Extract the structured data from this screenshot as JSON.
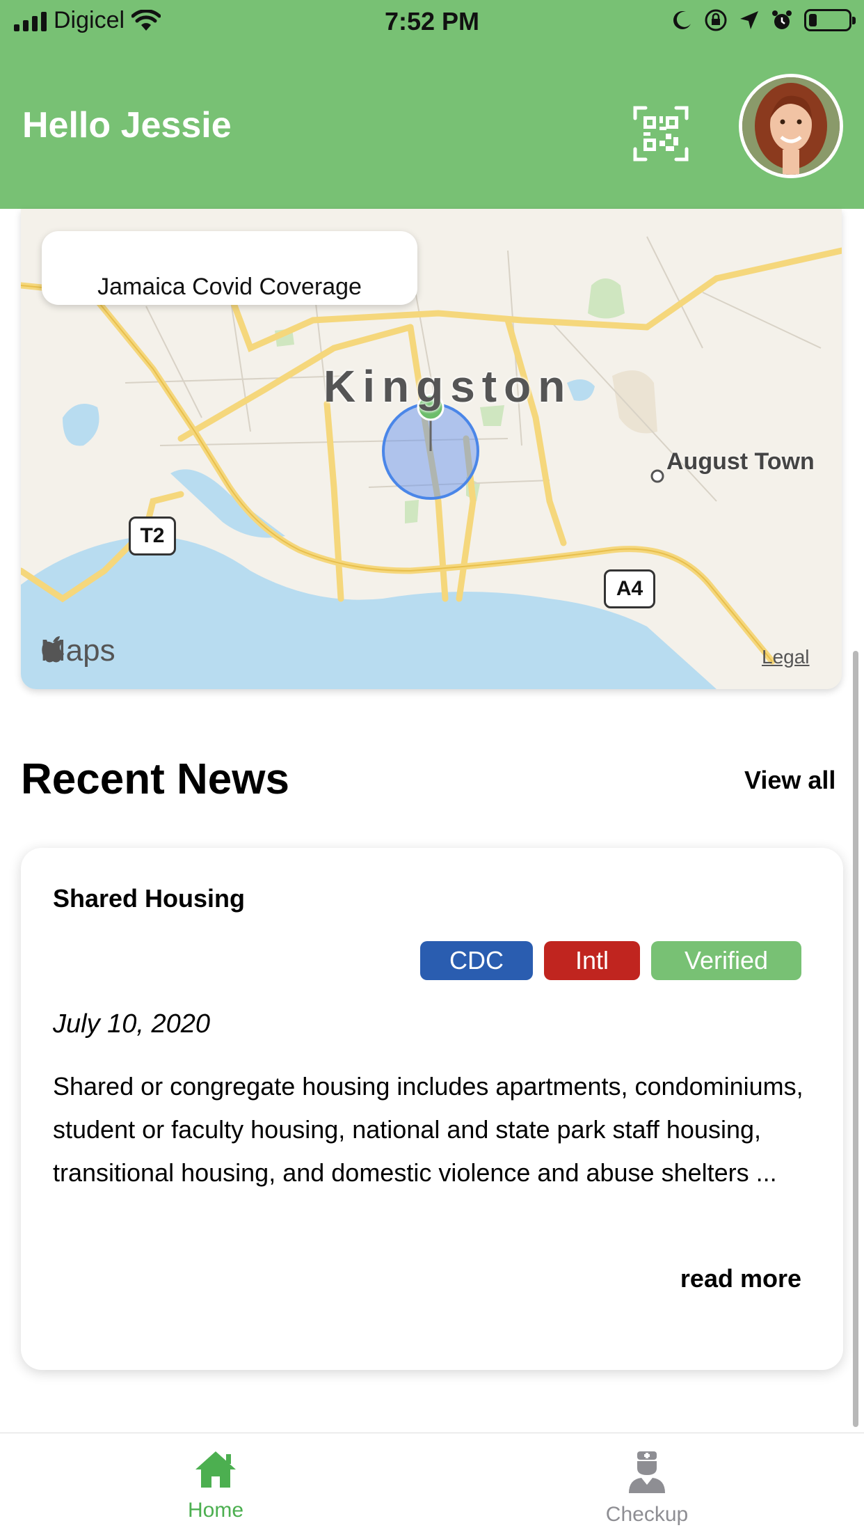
{
  "status_bar": {
    "carrier": "Digicel",
    "time": "7:52 PM",
    "battery_level": 0.2
  },
  "header": {
    "greeting": "Hello Jessie",
    "qr_icon": "qr-code-icon",
    "avatar": "user-avatar"
  },
  "map": {
    "overlay_title": "Jamaica Covid Coverage",
    "city_label": "Kingston",
    "town_label": "August Town",
    "road_labels": [
      "T2",
      "A4"
    ],
    "attribution": "Maps",
    "legal_label": "Legal"
  },
  "news": {
    "section_title": "Recent News",
    "view_all_label": "View all",
    "items": [
      {
        "title": "Shared Housing",
        "tags": [
          {
            "label": "CDC",
            "color": "#2a5db0"
          },
          {
            "label": "Intl",
            "color": "#c0251f"
          },
          {
            "label": "Verified",
            "color": "#78c174"
          }
        ],
        "date": "July 10, 2020",
        "summary": "Shared or congregate housing includes apartments, condominiums, student or faculty housing, national and state park staff housing, transitional housing, and domestic violence and abuse shelters ...",
        "read_more_label": "read more"
      }
    ]
  },
  "tab_bar": {
    "tabs": [
      {
        "label": "Home",
        "icon": "home-icon",
        "active": true
      },
      {
        "label": "Checkup",
        "icon": "doctor-icon",
        "active": false
      }
    ]
  },
  "colors": {
    "header_green": "#78c174",
    "active_tab": "#4caf50",
    "inactive_tab": "#8e8e93"
  }
}
